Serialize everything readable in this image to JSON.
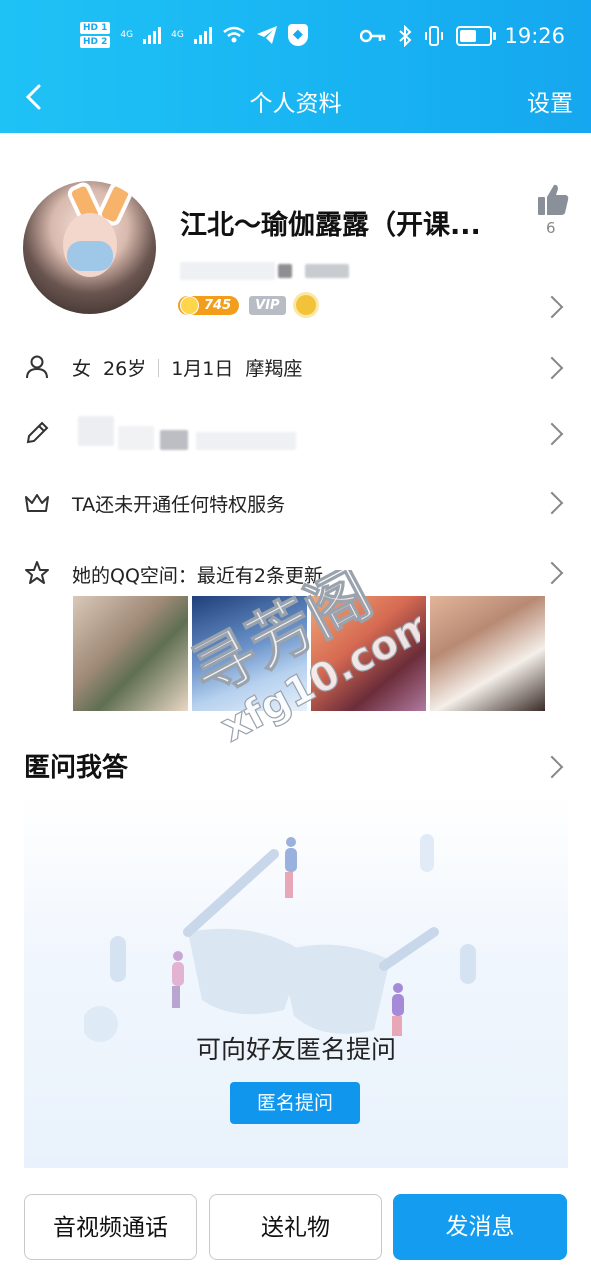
{
  "status_bar": {
    "time": "19:26",
    "sim1": "HD 1",
    "sim2": "HD 2",
    "network1": "4G",
    "network2": "4G"
  },
  "nav": {
    "title": "个人资料",
    "settings_label": "设置"
  },
  "profile": {
    "name": "江北～瑜伽露露（开课...",
    "coins": "745",
    "vip_label": "VIP",
    "likes": "6"
  },
  "info_row": {
    "gender": "女",
    "age": "26岁",
    "birthday": "1月1日",
    "zodiac": "摩羯座"
  },
  "privilege_row": {
    "text": "TA还未开通任何特权服务"
  },
  "qzone_row": {
    "text": "她的QQ空间：最近有2条更新"
  },
  "qa": {
    "title": "匿问我答",
    "prompt": "可向好友匿名提问",
    "button_label": "匿名提问"
  },
  "bottom_bar": {
    "call_label": "音视频通话",
    "gift_label": "送礼物",
    "message_label": "发消息"
  },
  "watermark": {
    "line1": "寻芳阁",
    "line2": "xfg10.com"
  },
  "colors": {
    "header_start": "#1fc2f5",
    "header_end": "#15a7ef",
    "primary": "#149cf0"
  }
}
